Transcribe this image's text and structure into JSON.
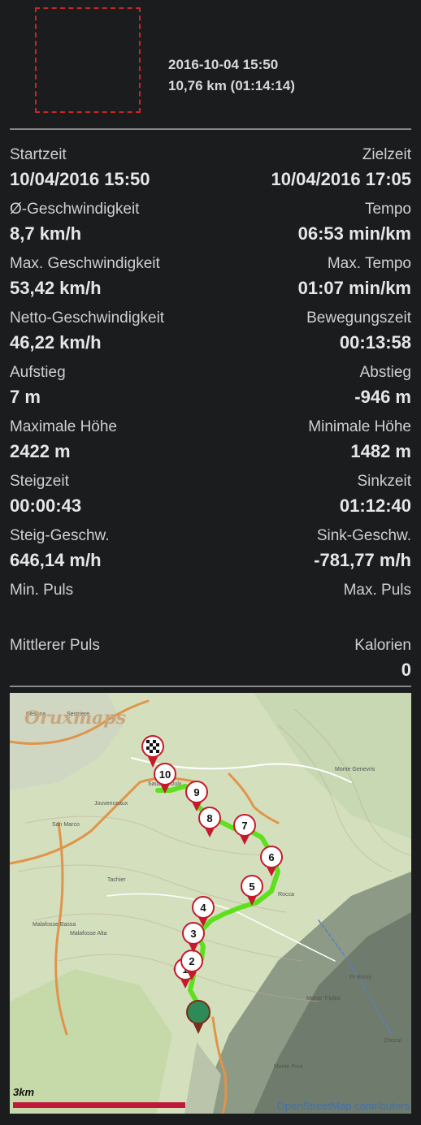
{
  "header": {
    "datetime": "2016-10-04 15:50",
    "distance_time": "10,76 km (01:14:14)"
  },
  "stats": [
    {
      "left_label": "Startzeit",
      "left_value": "10/04/2016 15:50",
      "right_label": "Zielzeit",
      "right_value": "10/04/2016 17:05"
    },
    {
      "left_label": "Ø-Geschwindigkeit",
      "left_value": "8,7 km/h",
      "right_label": "Tempo",
      "right_value": "06:53 min/km"
    },
    {
      "left_label": "Max. Geschwindigkeit",
      "left_value": "53,42 km/h",
      "right_label": "Max. Tempo",
      "right_value": "01:07 min/km"
    },
    {
      "left_label": "Netto-Geschwindigkeit",
      "left_value": "46,22 km/h",
      "right_label": "Bewegungszeit",
      "right_value": "00:13:58"
    },
    {
      "left_label": "Aufstieg",
      "left_value": "7 m",
      "right_label": "Abstieg",
      "right_value": "-946 m"
    },
    {
      "left_label": "Maximale Höhe",
      "left_value": "2422 m",
      "right_label": "Minimale Höhe",
      "right_value": "1482 m"
    },
    {
      "left_label": "Steigzeit",
      "left_value": "00:00:43",
      "right_label": "Sinkzeit",
      "right_value": "01:12:40"
    },
    {
      "left_label": "Steig-Geschw.",
      "left_value": "646,14 m/h",
      "right_label": "Sink-Geschw.",
      "right_value": "-781,77 m/h"
    },
    {
      "left_label": "Min. Puls",
      "left_value": "",
      "right_label": "Max. Puls",
      "right_value": ""
    },
    {
      "left_label": "Mittlerer Puls",
      "left_value": "",
      "right_label": "Kalorien",
      "right_value": "0"
    }
  ],
  "map": {
    "logo_a": "Orux",
    "logo_b": "maps",
    "scale_label": "3km",
    "attribution": "OpenStreetMap contributors",
    "place_labels": [
      "Cesana",
      "Sestriere",
      "Sauze d'Oulx",
      "Jouvenceaux",
      "San Marco",
      "Tachier",
      "Malafosse Bassa",
      "Malafosse Alta",
      "Rocca",
      "Monte Genevris",
      "Monte Triplex",
      "Monte Pina",
      "Chezal",
      "Pr Rente"
    ],
    "waypoints": [
      "1",
      "2",
      "3",
      "4",
      "5",
      "6",
      "7",
      "8",
      "9",
      "10"
    ],
    "colors": {
      "track": "#5ee01f",
      "pin": "#c41a2c",
      "start": "#2e8b57",
      "road": "#e0944a",
      "scale": "#c0183a"
    }
  }
}
